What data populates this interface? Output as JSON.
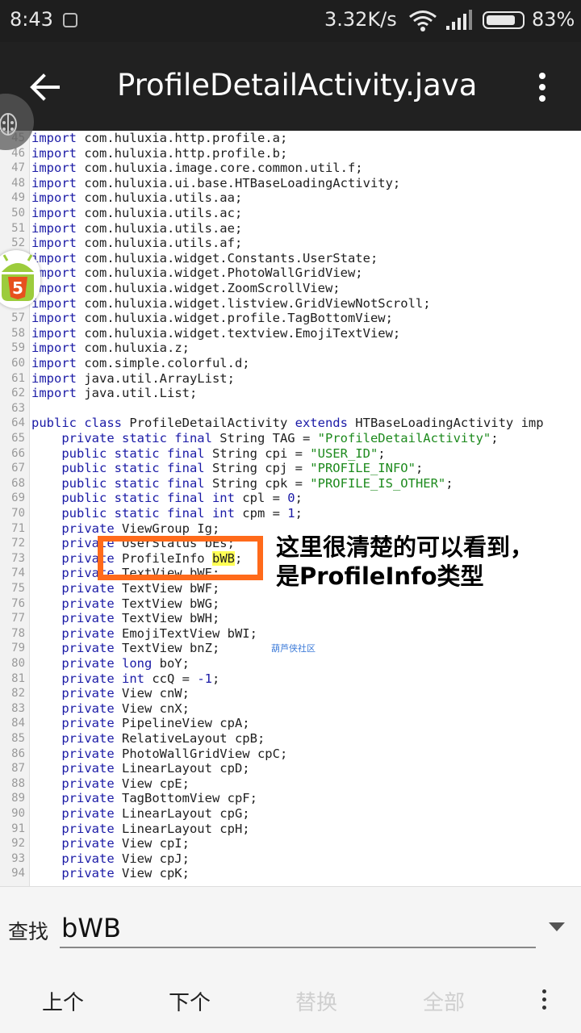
{
  "status_bar": {
    "time": "8:43",
    "net_speed": "3.32K/s",
    "battery_percent": "83%",
    "battery_level": 0.83
  },
  "app_bar": {
    "title": "ProfileDetailActivity.java",
    "back_icon": "arrow-back-icon",
    "menu_icon": "more-vert-icon"
  },
  "code": {
    "first_line": 45,
    "lines": [
      [
        [
          "kw",
          "import"
        ],
        [
          "t",
          " com.huluxia.http.profile.a;"
        ]
      ],
      [
        [
          "kw",
          "import"
        ],
        [
          "t",
          " com.huluxia.http.profile.b;"
        ]
      ],
      [
        [
          "kw",
          "import"
        ],
        [
          "t",
          " com.huluxia.image.core.common.util.f;"
        ]
      ],
      [
        [
          "kw",
          "import"
        ],
        [
          "t",
          " com.huluxia.ui.base.HTBaseLoadingActivity;"
        ]
      ],
      [
        [
          "kw",
          "import"
        ],
        [
          "t",
          " com.huluxia.utils.aa;"
        ]
      ],
      [
        [
          "kw",
          "import"
        ],
        [
          "t",
          " com.huluxia.utils.ac;"
        ]
      ],
      [
        [
          "kw",
          "import"
        ],
        [
          "t",
          " com.huluxia.utils.ae;"
        ]
      ],
      [
        [
          "kw",
          "import"
        ],
        [
          "t",
          " com.huluxia.utils.af;"
        ]
      ],
      [
        [
          "kw",
          "import"
        ],
        [
          "t",
          " com.huluxia.widget.Constants.UserState;"
        ]
      ],
      [
        [
          "kw",
          "import"
        ],
        [
          "t",
          " com.huluxia.widget.PhotoWallGridView;"
        ]
      ],
      [
        [
          "kw",
          "import"
        ],
        [
          "t",
          " com.huluxia.widget.ZoomScrollView;"
        ]
      ],
      [
        [
          "kw",
          "import"
        ],
        [
          "t",
          " com.huluxia.widget.listview.GridViewNotScroll;"
        ]
      ],
      [
        [
          "kw",
          "import"
        ],
        [
          "t",
          " com.huluxia.widget.profile.TagBottomView;"
        ]
      ],
      [
        [
          "kw",
          "import"
        ],
        [
          "t",
          " com.huluxia.widget.textview.EmojiTextView;"
        ]
      ],
      [
        [
          "kw",
          "import"
        ],
        [
          "t",
          " com.huluxia.z;"
        ]
      ],
      [
        [
          "kw",
          "import"
        ],
        [
          "t",
          " com.simple.colorful.d;"
        ]
      ],
      [
        [
          "kw",
          "import"
        ],
        [
          "t",
          " java.util.ArrayList;"
        ]
      ],
      [
        [
          "kw",
          "import"
        ],
        [
          "t",
          " java.util.List;"
        ]
      ],
      [],
      [
        [
          "kw",
          "public class"
        ],
        [
          "t",
          " ProfileDetailActivity "
        ],
        [
          "kw",
          "extends"
        ],
        [
          "t",
          " HTBaseLoadingActivity imp"
        ]
      ],
      [
        [
          "t",
          "    "
        ],
        [
          "kw",
          "private static final"
        ],
        [
          "t",
          " String TAG = "
        ],
        [
          "str",
          "\"ProfileDetailActivity\""
        ],
        [
          "t",
          ";"
        ]
      ],
      [
        [
          "t",
          "    "
        ],
        [
          "kw",
          "public static final"
        ],
        [
          "t",
          " String cpi = "
        ],
        [
          "str",
          "\"USER_ID\""
        ],
        [
          "t",
          ";"
        ]
      ],
      [
        [
          "t",
          "    "
        ],
        [
          "kw",
          "public static final"
        ],
        [
          "t",
          " String cpj = "
        ],
        [
          "str",
          "\"PROFILE_INFO\""
        ],
        [
          "t",
          ";"
        ]
      ],
      [
        [
          "t",
          "    "
        ],
        [
          "kw",
          "public static final"
        ],
        [
          "t",
          " String cpk = "
        ],
        [
          "str",
          "\"PROFILE_IS_OTHER\""
        ],
        [
          "t",
          ";"
        ]
      ],
      [
        [
          "t",
          "    "
        ],
        [
          "kw",
          "public static final int"
        ],
        [
          "t",
          " cpl = "
        ],
        [
          "num",
          "0"
        ],
        [
          "t",
          ";"
        ]
      ],
      [
        [
          "t",
          "    "
        ],
        [
          "kw",
          "public static final int"
        ],
        [
          "t",
          " cpm = "
        ],
        [
          "num",
          "1"
        ],
        [
          "t",
          ";"
        ]
      ],
      [
        [
          "t",
          "    "
        ],
        [
          "kw",
          "private"
        ],
        [
          "t",
          " ViewGroup Ig;"
        ]
      ],
      [
        [
          "t",
          "    "
        ],
        [
          "kw",
          "private"
        ],
        [
          "t",
          " UserStatus bEs;"
        ]
      ],
      [
        [
          "t",
          "    "
        ],
        [
          "kw",
          "private"
        ],
        [
          "t",
          " ProfileInfo "
        ],
        [
          "hl",
          "bWB"
        ],
        [
          "t",
          ";"
        ]
      ],
      [
        [
          "t",
          "    "
        ],
        [
          "kw",
          "private"
        ],
        [
          "t",
          " TextView bWE;"
        ]
      ],
      [
        [
          "t",
          "    "
        ],
        [
          "kw",
          "private"
        ],
        [
          "t",
          " TextView bWF;"
        ]
      ],
      [
        [
          "t",
          "    "
        ],
        [
          "kw",
          "private"
        ],
        [
          "t",
          " TextView bWG;"
        ]
      ],
      [
        [
          "t",
          "    "
        ],
        [
          "kw",
          "private"
        ],
        [
          "t",
          " TextView bWH;"
        ]
      ],
      [
        [
          "t",
          "    "
        ],
        [
          "kw",
          "private"
        ],
        [
          "t",
          " EmojiTextView bWI;"
        ]
      ],
      [
        [
          "t",
          "    "
        ],
        [
          "kw",
          "private"
        ],
        [
          "t",
          " TextView bnZ;"
        ]
      ],
      [
        [
          "t",
          "    "
        ],
        [
          "kw",
          "private long"
        ],
        [
          "t",
          " boY;"
        ]
      ],
      [
        [
          "t",
          "    "
        ],
        [
          "kw",
          "private int"
        ],
        [
          "t",
          " ccQ = "
        ],
        [
          "num",
          "-1"
        ],
        [
          "t",
          ";"
        ]
      ],
      [
        [
          "t",
          "    "
        ],
        [
          "kw",
          "private"
        ],
        [
          "t",
          " View cnW;"
        ]
      ],
      [
        [
          "t",
          "    "
        ],
        [
          "kw",
          "private"
        ],
        [
          "t",
          " View cnX;"
        ]
      ],
      [
        [
          "t",
          "    "
        ],
        [
          "kw",
          "private"
        ],
        [
          "t",
          " PipelineView cpA;"
        ]
      ],
      [
        [
          "t",
          "    "
        ],
        [
          "kw",
          "private"
        ],
        [
          "t",
          " RelativeLayout cpB;"
        ]
      ],
      [
        [
          "t",
          "    "
        ],
        [
          "kw",
          "private"
        ],
        [
          "t",
          " PhotoWallGridView cpC;"
        ]
      ],
      [
        [
          "t",
          "    "
        ],
        [
          "kw",
          "private"
        ],
        [
          "t",
          " LinearLayout cpD;"
        ]
      ],
      [
        [
          "t",
          "    "
        ],
        [
          "kw",
          "private"
        ],
        [
          "t",
          " View cpE;"
        ]
      ],
      [
        [
          "t",
          "    "
        ],
        [
          "kw",
          "private"
        ],
        [
          "t",
          " TagBottomView cpF;"
        ]
      ],
      [
        [
          "t",
          "    "
        ],
        [
          "kw",
          "private"
        ],
        [
          "t",
          " LinearLayout cpG;"
        ]
      ],
      [
        [
          "t",
          "    "
        ],
        [
          "kw",
          "private"
        ],
        [
          "t",
          " LinearLayout cpH;"
        ]
      ],
      [
        [
          "t",
          "    "
        ],
        [
          "kw",
          "private"
        ],
        [
          "t",
          " View cpI;"
        ]
      ],
      [
        [
          "t",
          "    "
        ],
        [
          "kw",
          "private"
        ],
        [
          "t",
          " View cpJ;"
        ]
      ],
      [
        [
          "t",
          "    "
        ],
        [
          "kw",
          "private"
        ],
        [
          "t",
          " View cpK;"
        ]
      ]
    ]
  },
  "watermark": "葫芦侠社区",
  "annotation": "这里很清楚的可以看到，是ProfileInfo类型",
  "find_bar": {
    "label": "查找",
    "query": "bWB",
    "dropdown_icon": "dropdown-arrow-icon"
  },
  "bottom_bar": {
    "prev": "上个",
    "next": "下个",
    "replace": "替换",
    "all": "全部",
    "more_icon": "more-vert-icon"
  },
  "colors": {
    "keyword": "#1a1aa6",
    "string": "#1d8a1d",
    "highlight": "#ffff55",
    "annotation_box": "#ff6a1a",
    "app_bar": "#212121"
  }
}
